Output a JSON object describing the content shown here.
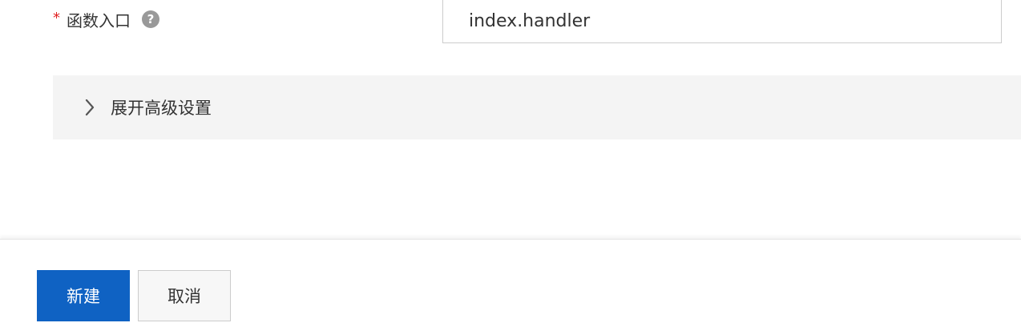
{
  "form": {
    "entry_label": "函数入口",
    "required_mark": "*",
    "help_icon_glyph": "?",
    "entry_value": "index.handler"
  },
  "advanced": {
    "label": "展开高级设置",
    "icon": "chevron-right-icon"
  },
  "footer": {
    "create_label": "新建",
    "cancel_label": "取消"
  },
  "colors": {
    "primary": "#0f62c3",
    "required": "#e02020",
    "panel_bg": "#f4f4f4"
  }
}
